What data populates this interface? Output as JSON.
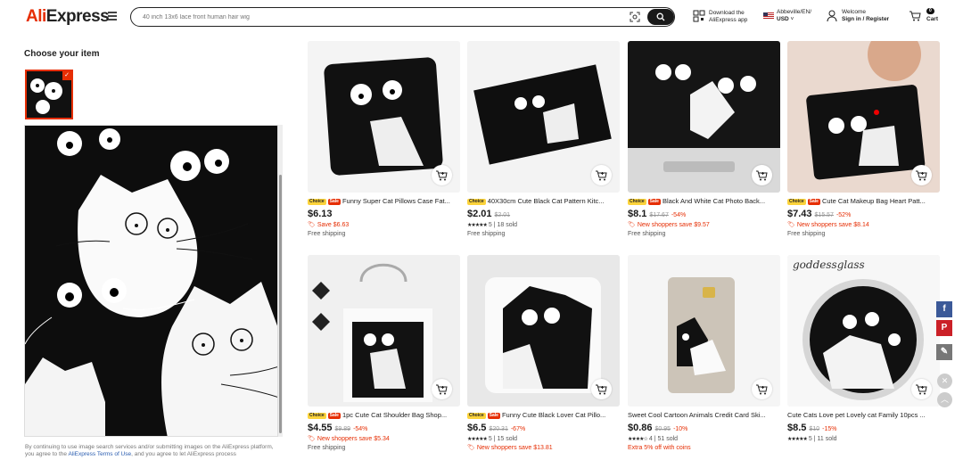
{
  "header": {
    "logo_red": "Ali",
    "logo_rest": "Express",
    "search_placeholder": "40 inch 13x6 lace front human hair wig",
    "app_line1": "Download the",
    "app_line2": "AliExpress app",
    "region_line1": "Abbeville/EN/",
    "region_line2": "USD",
    "account_line1": "Welcome",
    "account_line2": "Sign in / Register",
    "cart_count": "0",
    "cart_label": "Cart"
  },
  "left": {
    "title": "Choose your item",
    "footnote_before": "By continuing to use image search services and/or submitting images on the AliExpress platform, you agree to the ",
    "footnote_link": "AliExpress Terms of Use",
    "footnote_after": ", and you agree to let AliExpress process"
  },
  "products": [
    {
      "title": "Funny Super Cat Pillows Case Fat...",
      "choice": true,
      "sale": true,
      "price": "$6.13",
      "old": "",
      "disc": "",
      "line1": "Save $6.63",
      "line1_red": true,
      "stars": "",
      "rating": "",
      "sold": "",
      "line2": "Free shipping"
    },
    {
      "title": "40X30cm Cute Black Cat Pattern Kitc...",
      "choice": true,
      "sale": false,
      "price": "$2.01",
      "old": "$2.01",
      "disc": "",
      "line1": "",
      "line1_red": false,
      "stars": "★★★★★",
      "rating": "5",
      "sold": "18 sold",
      "line2": "Free shipping"
    },
    {
      "title": "Black And White Cat Photo Back...",
      "choice": true,
      "sale": true,
      "price": "$8.1",
      "old": "$17.67",
      "disc": "-54%",
      "line1": "New shoppers save $9.57",
      "line1_red": true,
      "stars": "",
      "rating": "",
      "sold": "",
      "line2": "Free shipping"
    },
    {
      "title": "Cute Cat Makeup Bag Heart Patt...",
      "choice": true,
      "sale": true,
      "price": "$7.43",
      "old": "$15.57",
      "disc": "-52%",
      "line1": "New shoppers save $8.14",
      "line1_red": true,
      "stars": "",
      "rating": "",
      "sold": "",
      "line2": "Free shipping"
    },
    {
      "title": "1pc Cute Cat Shoulder Bag Shop...",
      "choice": true,
      "sale": true,
      "price": "$4.55",
      "old": "$9.89",
      "disc": "-54%",
      "line1": "New shoppers save $5.34",
      "line1_red": true,
      "stars": "",
      "rating": "",
      "sold": "",
      "line2": "Free shipping"
    },
    {
      "title": "Funny Cute Black Lover Cat Pillo...",
      "choice": true,
      "sale": true,
      "price": "$6.5",
      "old": "$20.31",
      "disc": "-67%",
      "line1": "",
      "line1_red": false,
      "stars": "★★★★★",
      "rating": "5",
      "sold": "15 sold",
      "line2": "New shoppers save $13.81"
    },
    {
      "title": "Sweet Cool Cartoon Animals Credit Card Ski...",
      "choice": false,
      "sale": false,
      "price": "$0.86",
      "old": "$0.95",
      "disc": "-10%",
      "line1": "",
      "line1_red": false,
      "stars": "★★★★☆",
      "rating": "4",
      "sold": "51 sold",
      "line2": "Extra 5% off with coins"
    },
    {
      "title": "Cute Cats Love pet Lovely cat Family 10pcs ...",
      "choice": false,
      "sale": false,
      "price": "$8.5",
      "old": "$10",
      "disc": "-15%",
      "line1": "",
      "line1_red": false,
      "stars": "★★★★★",
      "rating": "5",
      "sold": "11 sold",
      "line2": ""
    }
  ],
  "badges": {
    "choice": "Choice",
    "sale": "Sale"
  },
  "card8_brand": "goddessglass",
  "social": {
    "facebook": "f",
    "pinterest": "P"
  }
}
